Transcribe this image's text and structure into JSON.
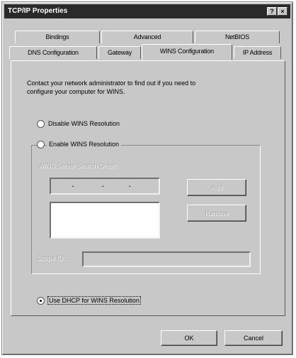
{
  "window": {
    "title": "TCP/IP Properties"
  },
  "tabs": {
    "row1": [
      "Bindings",
      "Advanced",
      "NetBIOS"
    ],
    "row2": [
      "DNS Configuration",
      "Gateway",
      "WINS Configuration",
      "IP Address"
    ],
    "active": "WINS Configuration"
  },
  "panel": {
    "description": "Contact your network administrator to find out if you need to configure your computer for WINS.",
    "description_line1": "Contact your network administrator to find out if you need to",
    "description_line2": "configure your computer for WINS.",
    "disable_label": "Disable WINS Resolution",
    "enable_label": "Enable WINS Resolution",
    "search_order_label": "WINS Server Search Order:",
    "ip_dots": [
      ".",
      ".",
      "."
    ],
    "add_button": "Add",
    "remove_button": "Remove",
    "scope_label": "Scope ID:",
    "dhcp_label": "Use DHCP for WINS Resolution",
    "selected_option": "Use DHCP for WINS Resolution"
  },
  "footer": {
    "ok": "OK",
    "cancel": "Cancel"
  },
  "title_buttons": {
    "help": "?",
    "close": "×"
  }
}
